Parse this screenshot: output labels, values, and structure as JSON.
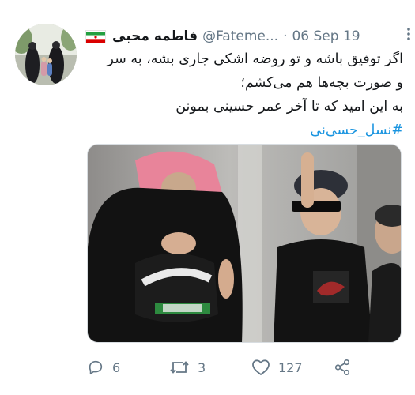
{
  "tweet": {
    "author_name": "فاطمه محبی",
    "author_handle": "@Fateme...",
    "separator": "·",
    "date": "06 Sep 19",
    "text_lines": [
      "اگر توفیق باشه و تو روضه اشکی جاری بشه، به سر",
      "و صورت بچه‌ها هم می‌کشم؛",
      "به این امید که تا آخر عمر حسینی بمونن"
    ],
    "hashtag": "#نسل_حسی‌نی"
  },
  "actions": {
    "reply_count": "6",
    "retweet_count": "3",
    "like_count": "127"
  },
  "icons": {
    "reply": "reply-icon",
    "retweet": "retweet-icon",
    "like": "heart-icon",
    "share": "share-icon",
    "more": "more-vertical-icon",
    "flag": "iran-flag-icon"
  },
  "colors": {
    "link": "#1b95e0",
    "muted": "#657786",
    "text": "#14171a"
  }
}
